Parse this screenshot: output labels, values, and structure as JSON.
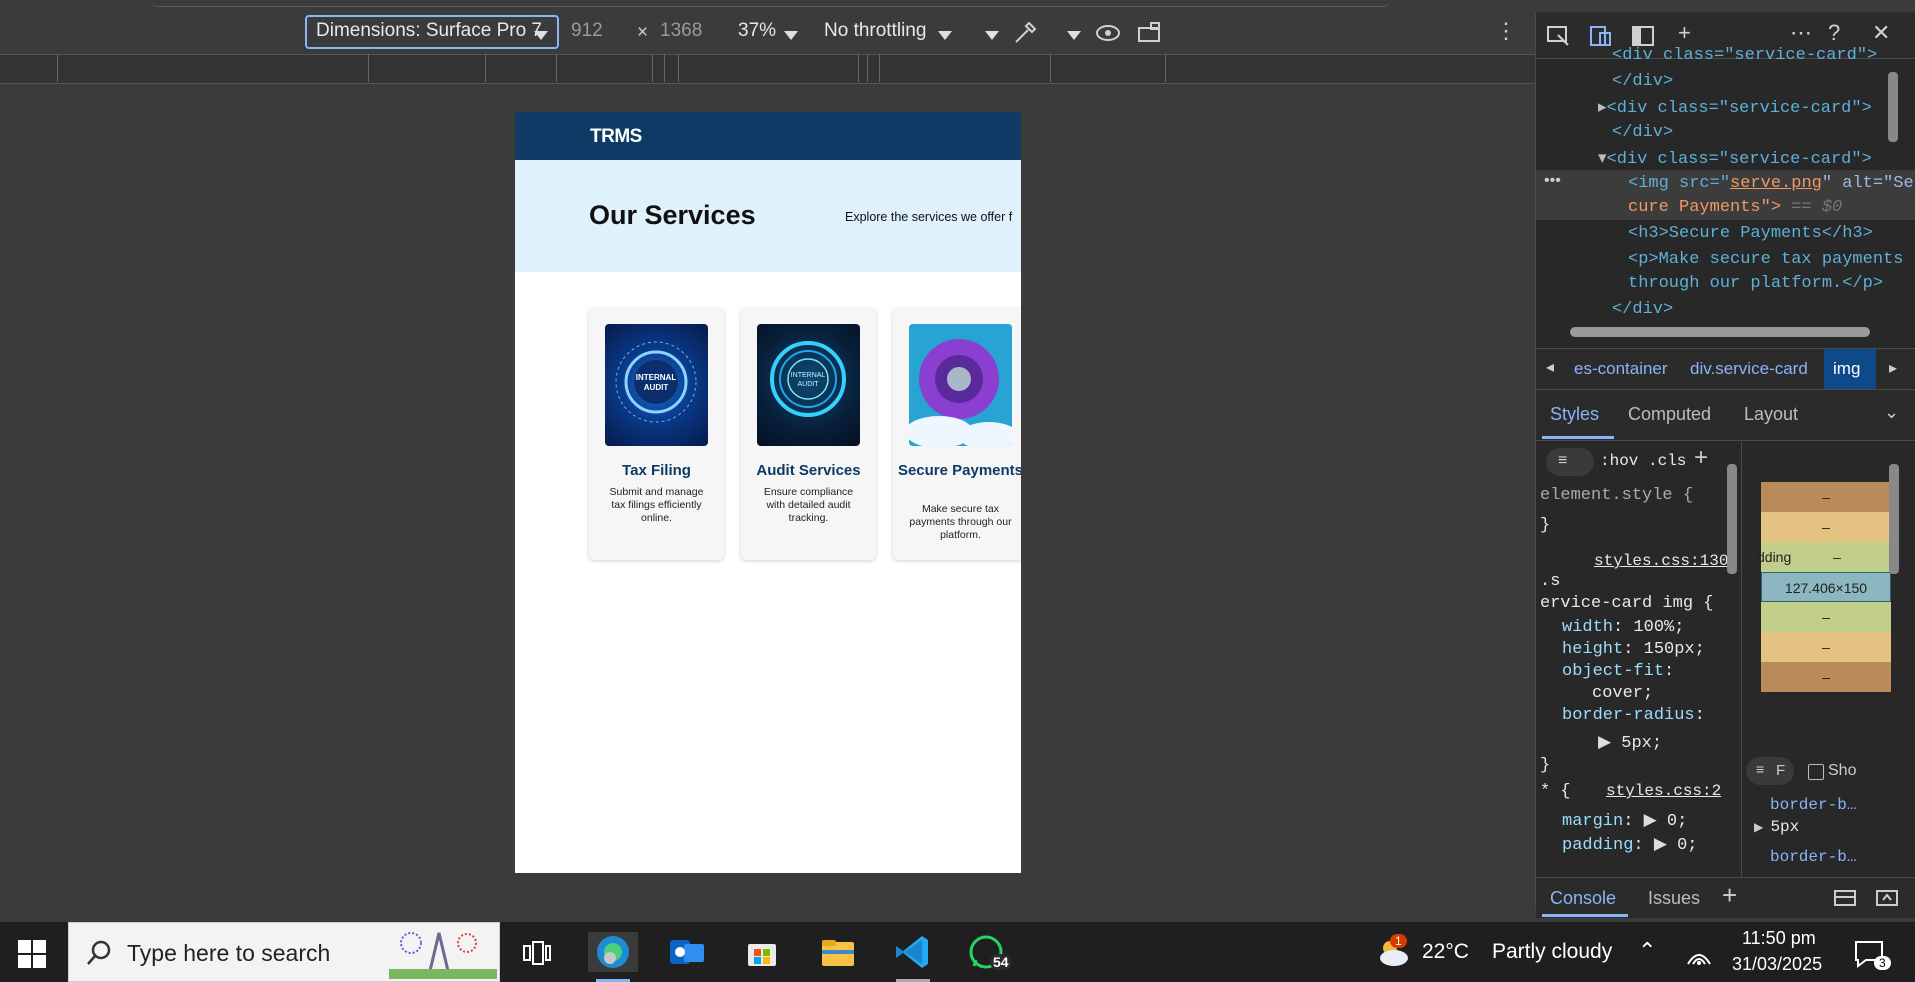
{
  "device_toolbar": {
    "dimensions_label": "Dimensions: Surface Pro 7",
    "width": "912",
    "times": "×",
    "height": "1368",
    "zoom": "37%",
    "throttling": "No throttling"
  },
  "page": {
    "brand": "TRMS",
    "hero_title": "Our Services",
    "hero_subtitle": "Explore the services we offer f",
    "cards": [
      {
        "title": "Tax Filing",
        "desc": "Submit and manage tax filings efficiently online.",
        "img_text": "INTERNAL AUDIT"
      },
      {
        "title": "Audit Services",
        "desc": "Ensure compliance with detailed audit tracking.",
        "img_text": "INTERNAL AUDIT"
      },
      {
        "title": "Secure Payments",
        "desc": "Make secure tax payments through our platform.",
        "img_text": ""
      }
    ]
  },
  "devtools": {
    "dom_lines": [
      {
        "indent": 0,
        "parts": [
          [
            "tag",
            "▸<div "
          ],
          [
            "attr",
            "class"
          ],
          [
            "tag",
            "="
          ],
          [
            "val",
            "\"service-card\""
          ],
          [
            "tag",
            "></div>"
          ]
        ]
      }
    ],
    "dom": {
      "line0": "<div class=\"service-card\">",
      "line1": "</div>",
      "line2": "<div class=\"service-card\">",
      "line3": "</div>",
      "line4": "<div class=\"service-card\">",
      "img_open": "<img src=\"",
      "img_src": "serve.png",
      "img_alt": "\" alt=\"Se",
      "img_alt2": "cure Payments\">",
      "img_eq": "== $0",
      "h3": "<h3>Secure Payments</h3>",
      "p1": "<p>Make secure tax payments",
      "p2": "through our platform.</p>",
      "close": "</div>"
    },
    "breadcrumbs": [
      "es-container",
      "div.service-card",
      "img"
    ],
    "tabs": [
      "Styles",
      "Computed",
      "Layout"
    ],
    "filter_hov": ":hov",
    "filter_cls": ".cls",
    "styles": {
      "element_style": "element.style {",
      "close": "}",
      "source1": "styles.css:130",
      "selector1a": ".s",
      "selector1b": "ervice-card img {",
      "rules1": [
        {
          "prop": "width",
          "value": "100%;"
        },
        {
          "prop": "height",
          "value": "150px;"
        },
        {
          "prop": "object-fit",
          "value": ""
        },
        {
          "prop": "",
          "value": "cover;"
        },
        {
          "prop": "border-radius",
          "value": ""
        },
        {
          "prop": "",
          "value": "5px;"
        }
      ],
      "source2": "styles.css:2",
      "selector2": "* {",
      "rules2": [
        {
          "prop": "margin",
          "value": "0;"
        },
        {
          "prop": "padding",
          "value": "0;"
        }
      ]
    },
    "boxmodel": {
      "padding_label": "dding",
      "dash": "–",
      "content_size": "127.406×150"
    },
    "computed_filter": "F",
    "show_all": "Sho",
    "computed_props": [
      {
        "name": "border-b…",
        "value": "5px"
      },
      {
        "name": "border-b…",
        "value": ""
      }
    ],
    "drawer_tabs": [
      "Console",
      "Issues"
    ]
  },
  "taskbar": {
    "search_placeholder": "Type here to search",
    "whatsapp_badge": "54",
    "weather_badge": "1",
    "temperature": "22°C",
    "weather": "Partly cloudy",
    "time": "11:50 pm",
    "date": "31/03/2025",
    "notifications": "3"
  },
  "colors": {
    "navbar": "#0d3b66",
    "hero_bg": "#dff1fb",
    "devtools_accent": "#8ab4f8",
    "taskbar": "#1f1f1f"
  }
}
